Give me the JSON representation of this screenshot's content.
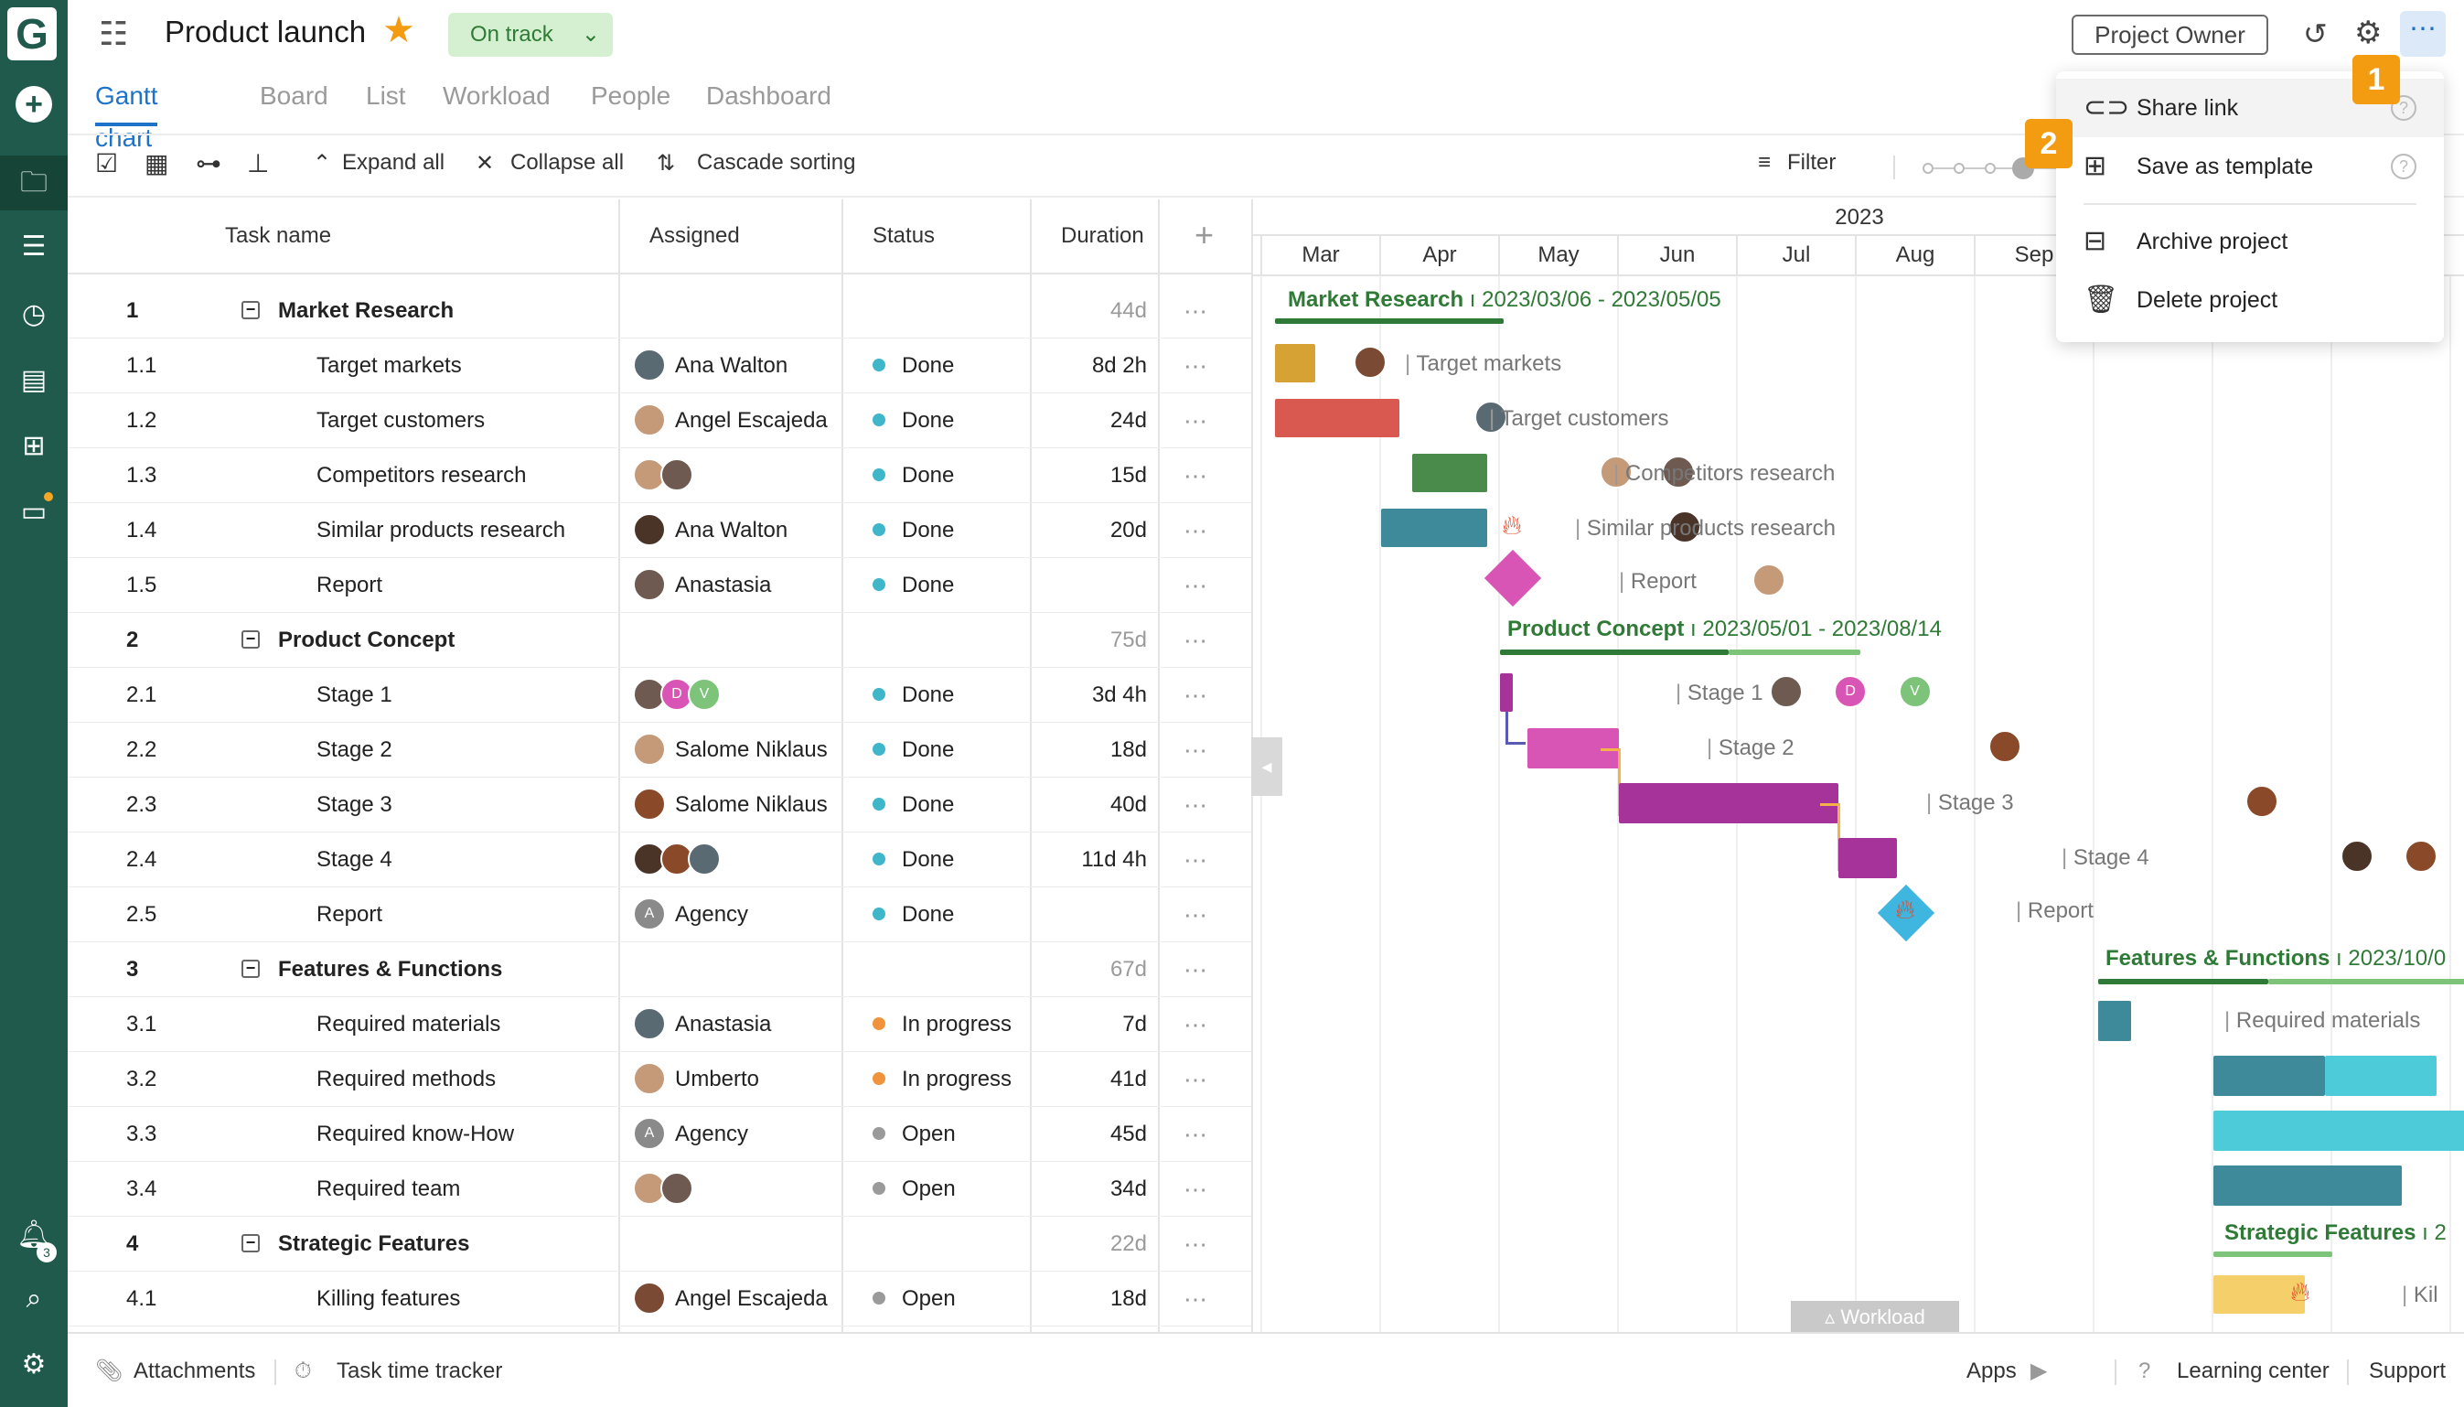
{
  "app": {
    "logo_letter": "G"
  },
  "header": {
    "title": "Product launch",
    "status": "On track",
    "owner_button": "Project Owner"
  },
  "tabs": [
    "Gantt chart",
    "Board",
    "List",
    "Workload",
    "People",
    "Dashboard"
  ],
  "toolbar": {
    "expand_all": "Expand all",
    "collapse_all": "Collapse all",
    "cascade_sorting": "Cascade sorting",
    "filter": "Filter"
  },
  "columns": {
    "task_name": "Task name",
    "assigned": "Assigned",
    "status": "Status",
    "duration": "Duration"
  },
  "rows": [
    {
      "num": "1",
      "name": "Market Research",
      "group": true,
      "assigned": "",
      "status": "",
      "duration": "44d"
    },
    {
      "num": "1.1",
      "name": "Target markets",
      "assigned": "Ana Walton",
      "status": "Done",
      "duration": "8d 2h"
    },
    {
      "num": "1.2",
      "name": "Target customers",
      "assigned": "Angel Escajeda",
      "status": "Done",
      "duration": "24d"
    },
    {
      "num": "1.3",
      "name": "Competitors research",
      "assigned": "",
      "status": "Done",
      "duration": "15d"
    },
    {
      "num": "1.4",
      "name": "Similar products research",
      "assigned": "Ana Walton",
      "status": "Done",
      "duration": "20d"
    },
    {
      "num": "1.5",
      "name": "Report",
      "assigned": "Anastasia",
      "status": "Done",
      "duration": ""
    },
    {
      "num": "2",
      "name": "Product Concept",
      "group": true,
      "assigned": "",
      "status": "",
      "duration": "75d"
    },
    {
      "num": "2.1",
      "name": "Stage 1",
      "assigned": "",
      "status": "Done",
      "duration": "3d 4h"
    },
    {
      "num": "2.2",
      "name": "Stage 2",
      "assigned": "Salome Niklaus",
      "status": "Done",
      "duration": "18d"
    },
    {
      "num": "2.3",
      "name": "Stage 3",
      "assigned": "Salome Niklaus",
      "status": "Done",
      "duration": "40d"
    },
    {
      "num": "2.4",
      "name": "Stage 4",
      "assigned": "",
      "status": "Done",
      "duration": "11d 4h"
    },
    {
      "num": "2.5",
      "name": "Report",
      "assigned": "Agency",
      "status": "Done",
      "duration": ""
    },
    {
      "num": "3",
      "name": "Features & Functions",
      "group": true,
      "assigned": "",
      "status": "",
      "duration": "67d"
    },
    {
      "num": "3.1",
      "name": "Required materials",
      "assigned": "Anastasia",
      "status": "In progress",
      "duration": "7d"
    },
    {
      "num": "3.2",
      "name": "Required methods",
      "assigned": "Umberto",
      "status": "In progress",
      "duration": "41d"
    },
    {
      "num": "3.3",
      "name": "Required know-How",
      "assigned": "Agency",
      "status": "Open",
      "duration": "45d"
    },
    {
      "num": "3.4",
      "name": "Required team",
      "assigned": "",
      "status": "Open",
      "duration": "34d"
    },
    {
      "num": "4",
      "name": "Strategic Features",
      "group": true,
      "assigned": "",
      "status": "",
      "duration": "22d"
    },
    {
      "num": "4.1",
      "name": "Killing features",
      "assigned": "Angel Escajeda",
      "status": "Open",
      "duration": "18d"
    }
  ],
  "gantt": {
    "year": "2023",
    "months": [
      "Mar",
      "Apr",
      "May",
      "Jun",
      "Jul",
      "Aug",
      "Sep"
    ],
    "groups": {
      "market_research": {
        "name": "Market Research",
        "dates": "2023/03/06 - 2023/05/05"
      },
      "product_concept": {
        "name": "Product Concept",
        "dates": "2023/05/01 - 2023/08/14"
      },
      "features": {
        "name": "Features & Functions",
        "dates": "2023/10/0"
      },
      "strategic": {
        "name": "Strategic Features",
        "dates": "2"
      }
    },
    "labels": {
      "target_markets": "Target markets",
      "target_customers": "Target customers",
      "competitors": "Competitors research",
      "similar": "Similar products research",
      "report1": "Report",
      "stage1": "Stage 1",
      "stage2": "Stage 2",
      "stage3": "Stage 3",
      "stage4": "Stage 4",
      "report2": "Report",
      "req_materials": "Required materials",
      "killing": "Kil"
    },
    "workload_tab": "Workload"
  },
  "menu": {
    "share_link": "Share link",
    "save_template": "Save as template",
    "archive": "Archive project",
    "delete": "Delete project",
    "badge1": "1",
    "badge2": "2"
  },
  "footer": {
    "attachments": "Attachments",
    "time_tracker": "Task time tracker",
    "apps": "Apps",
    "learning": "Learning center",
    "support": "Support"
  },
  "notifications_count": "3",
  "colors": {
    "sidebar": "#1f5a4c",
    "accent": "#1c73c9",
    "done": "#3fb6c9",
    "in_progress": "#f0933a",
    "open": "#9a9a9a",
    "group_bar": "#2f7a36"
  }
}
